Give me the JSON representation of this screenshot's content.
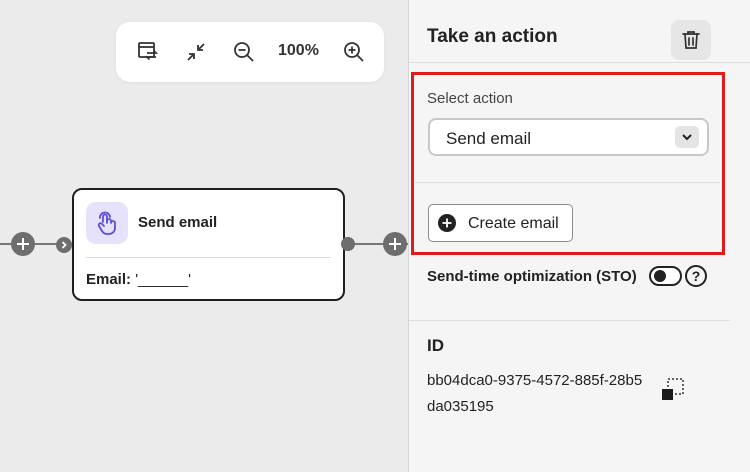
{
  "toolbar": {
    "zoom": "100%",
    "icons": [
      "swap-layout-icon",
      "shrink-icon",
      "zoom-out-icon",
      "zoom-in-icon"
    ]
  },
  "node": {
    "title": "Send email",
    "field_label": "Email:",
    "field_value": "'______'",
    "icon": "touch-hand-icon"
  },
  "panel": {
    "title": "Take an action",
    "select_label": "Select action",
    "select_value": "Send email",
    "create_label": "Create email",
    "sto_label": "Send-time optimization (STO)",
    "help": "?",
    "id_label": "ID",
    "id_value": "bb04dca0-9375-4572-885f-28b5da035195"
  },
  "colors": {
    "highlight": "#e01b1b",
    "node_icon_bg": "#e6e2fb",
    "node_icon_fg": "#5b4fd8",
    "canvas": "#ebebeb",
    "panel": "#f5f5f5"
  }
}
